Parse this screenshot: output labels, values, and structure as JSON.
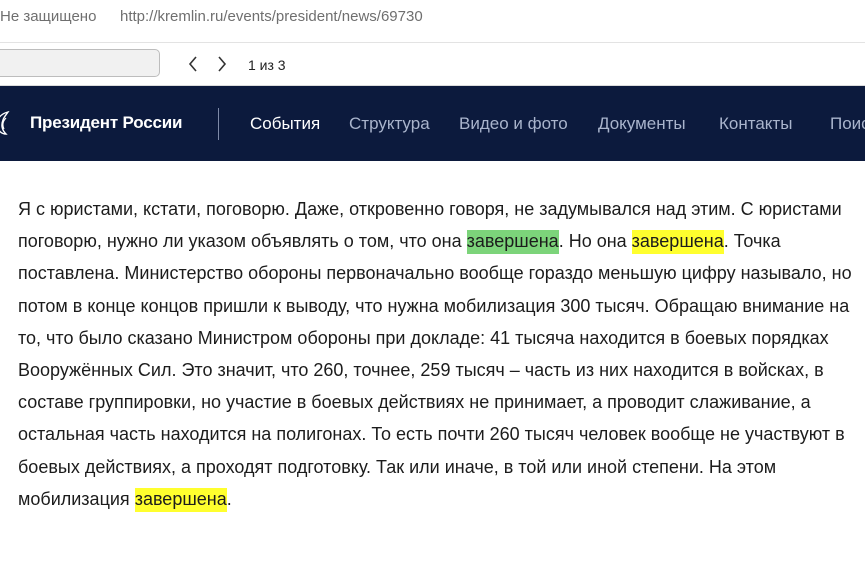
{
  "browser": {
    "security_label": "Не защищено",
    "url": "http://kremlin.ru/events/president/news/69730"
  },
  "find_bar": {
    "query": "",
    "count": "1 из 3"
  },
  "site": {
    "title": "Президент России",
    "nav": [
      "События",
      "Структура",
      "Видео и фото",
      "Документы",
      "Контакты",
      "Поис"
    ],
    "active_nav": "События"
  },
  "article": {
    "segments": [
      "Я с юристами, кстати, поговорю. Даже, откровенно говоря, не задумывался над этим. С юристами поговорю, нужно ли указом объявлять о том, что она ",
      "завершена",
      ". Но она ",
      "завершена",
      ". Точка поставлена. Министерство обороны первоначально вообще гораздо меньшую цифру называло, но потом в конце концов пришли к выводу, что нужна мобилизация 300 тысяч. Обращаю внимание на то, что было сказано Министром обороны при докладе: 41 тысяча находится в боевых порядках Вооружённых Сил. Это значит, что 260, точнее, 259 тысяч – часть из них находится в войсках, в составе группировки, но участие в боевых действиях не принимает, а проводит слаживание, а остальная часть находится на полигонах. То есть почти 260 тысяч человек вообще не участвуют в боевых действиях, а проходят подготовку. Так или иначе, в той или иной степени. На этом мобилизация ",
      "завершена",
      "."
    ]
  },
  "colors": {
    "nav_background": "#0c1a3d",
    "highlight_current": "#7cd47a",
    "highlight_match": "#ffff2e"
  },
  "icons": {
    "find_prev": "chevron-left-icon",
    "find_next": "chevron-right-icon",
    "emblem": "eagle-emblem-icon"
  }
}
